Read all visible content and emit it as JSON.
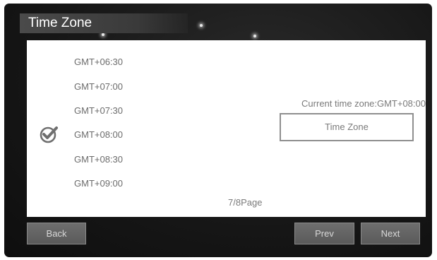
{
  "title": "Time Zone",
  "time_zones": [
    {
      "label": "GMT+06:30",
      "selected": false
    },
    {
      "label": "GMT+07:00",
      "selected": false
    },
    {
      "label": "GMT+07:30",
      "selected": false
    },
    {
      "label": "GMT+08:00",
      "selected": true
    },
    {
      "label": "GMT+08:30",
      "selected": false
    },
    {
      "label": "GMT+09:00",
      "selected": false
    }
  ],
  "selected_icon": "checkmark-circle-icon",
  "current_time_zone_text": "Current time zone:GMT+08:00",
  "time_zone_button_label": "Time Zone",
  "page_info": "7/8Page",
  "buttons": {
    "back": "Back",
    "prev": "Prev",
    "next": "Next"
  },
  "colors": {
    "background": "#161616",
    "panel": "#ffffff",
    "text": "#6c6c6c",
    "button": "#5e5e5e"
  }
}
